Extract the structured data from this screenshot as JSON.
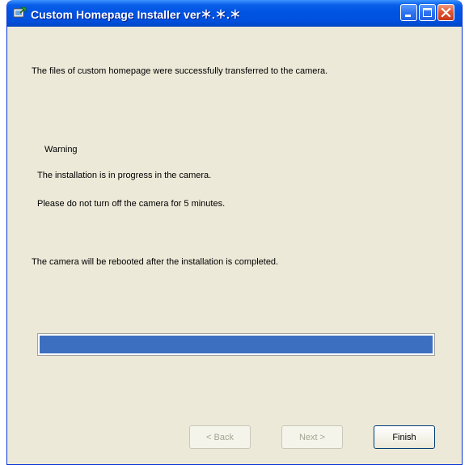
{
  "window": {
    "title": "Custom Homepage Installer  ver＊.＊.＊",
    "icon": "installer-app-icon"
  },
  "titlebar_buttons": {
    "minimize": "minimize-icon",
    "maximize": "maximize-icon",
    "close": "close-icon"
  },
  "messages": {
    "success": "The files of custom homepage were successfully transferred to the camera.",
    "warning_title": "Warning",
    "warning_line1": "The installation is in progress in the camera.",
    "warning_line2": "Please do not turn off the camera for 5 minutes.",
    "reboot_note": "The camera will be rebooted after the installation is completed."
  },
  "progress": {
    "value_percent": 100,
    "color": "#3d6fc0"
  },
  "buttons": {
    "back": "< Back",
    "next": "Next >",
    "finish": "Finish"
  },
  "colors": {
    "title_bar": "#0054e3",
    "dialog_bg": "#ece9d8",
    "close_button": "#e0552f"
  }
}
